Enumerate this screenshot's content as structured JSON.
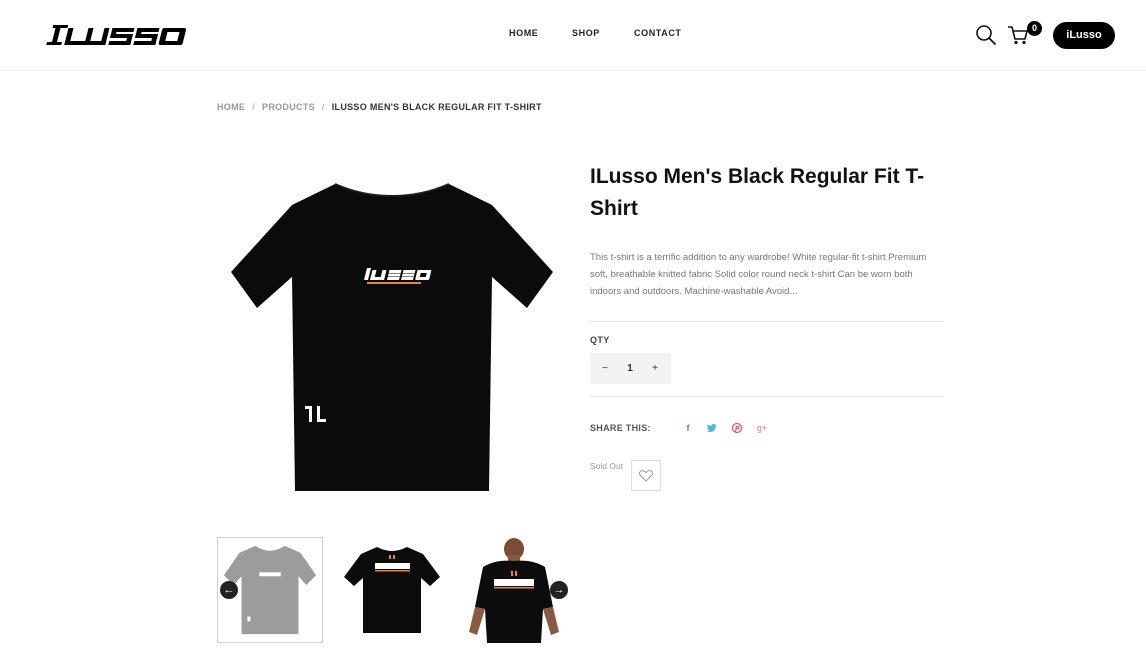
{
  "header": {
    "logo_text": "ilusso",
    "nav": {
      "home": "HOME",
      "shop": "SHOP",
      "contact": "CONTACT"
    },
    "cart_count": "0",
    "account_label": "iLusso",
    "icons": [
      "search-icon",
      "cart-icon"
    ]
  },
  "breadcrumb": {
    "home": "HOME",
    "separator": "/",
    "products": "PRODUCTS",
    "current": "ILUSSO MEN'S BLACK REGULAR FIT T-SHIRT"
  },
  "product": {
    "title": "ILusso Men's Black Regular Fit T-Shirt",
    "description": "This t-shirt is a terrific addition to any wardrobe! White regular-fit t-shirt Premium soft, breathable knitted fabric Solid color round neck t-shirt Can be worn both indoors and outdoors. Machine-washable Avoid...",
    "qty_label": "QTY",
    "qty_minus": "−",
    "qty_value": "1",
    "qty_plus": "+",
    "share_label": "SHARE THIS:",
    "social": {
      "facebook": "f",
      "twitter": "🐦",
      "pinterest": "℘",
      "google": "g+"
    },
    "status": "Sold Out"
  },
  "gallery": {
    "thumbnails": [
      "grey t-shirt front",
      "black t-shirt back",
      "model wearing black t-shirt"
    ],
    "prev_arrow": "←",
    "next_arrow": "→"
  },
  "colors": {
    "accent": "#000000",
    "tshirt": "#0b0b0b",
    "thumb_grey": "#9c9c9c",
    "logo_orange": "#e9823a"
  }
}
